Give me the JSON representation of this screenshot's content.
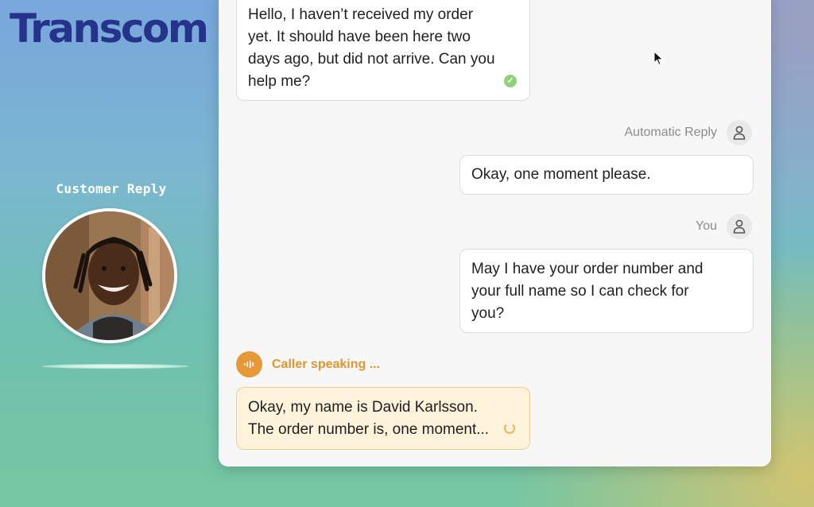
{
  "brand": {
    "logo_text": "Transcom",
    "color": "#25348a"
  },
  "customer_panel": {
    "label": "Customer Reply"
  },
  "chat": {
    "messages": [
      {
        "from": "customer",
        "lines": [
          "Hello, I haven’t received my order",
          "yet. It should have been here two",
          "days ago, but did not arrive. Can you",
          "help me?"
        ],
        "status_icon": "check-icon"
      },
      {
        "from": "agent",
        "sender": "Automatic Reply",
        "lines": [
          "Okay, one moment please."
        ]
      },
      {
        "from": "agent",
        "sender": "You",
        "lines": [
          "May I have your order number and",
          "your full name so I can check for",
          "you?"
        ]
      },
      {
        "from": "customer-live",
        "status": "Caller speaking ...",
        "lines": [
          "Okay, my name is David Karlsson.",
          "The order number is, one moment..."
        ],
        "status_icon": "loading-spinner-icon"
      }
    ]
  },
  "colors": {
    "accent_orange": "#e59a37",
    "live_bubble_bg": "#fdf3da"
  }
}
